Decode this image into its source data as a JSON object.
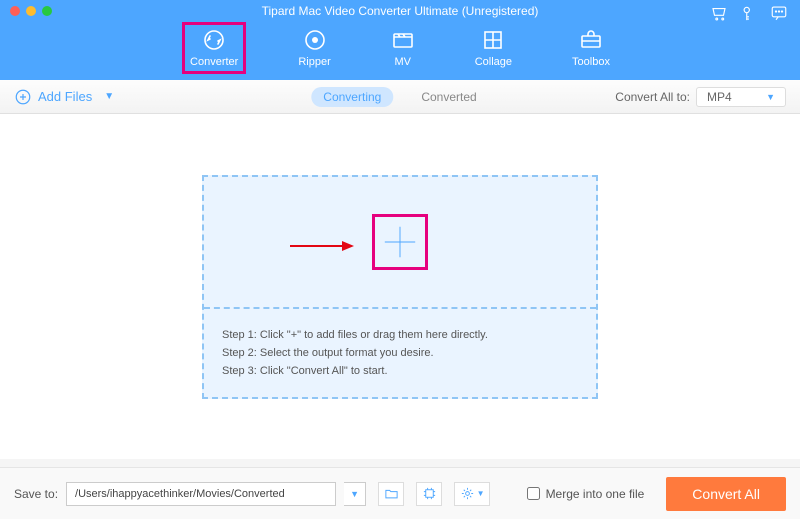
{
  "app": {
    "title": "Tipard Mac Video Converter Ultimate (Unregistered)"
  },
  "nav": {
    "converter": "Converter",
    "ripper": "Ripper",
    "mv": "MV",
    "collage": "Collage",
    "toolbox": "Toolbox"
  },
  "toolbar": {
    "add_files": "Add Files",
    "tab_converting": "Converting",
    "tab_converted": "Converted",
    "convert_all_to": "Convert All to:",
    "format": "MP4"
  },
  "dropzone": {
    "step1": "Step 1: Click \"+\" to add files or drag them here directly.",
    "step2": "Step 2: Select the output format you desire.",
    "step3": "Step 3: Click \"Convert All\" to start."
  },
  "footer": {
    "save_to_label": "Save to:",
    "save_path": "/Users/ihappyacethinker/Movies/Converted",
    "merge_label": "Merge into one file",
    "convert_all": "Convert All"
  }
}
